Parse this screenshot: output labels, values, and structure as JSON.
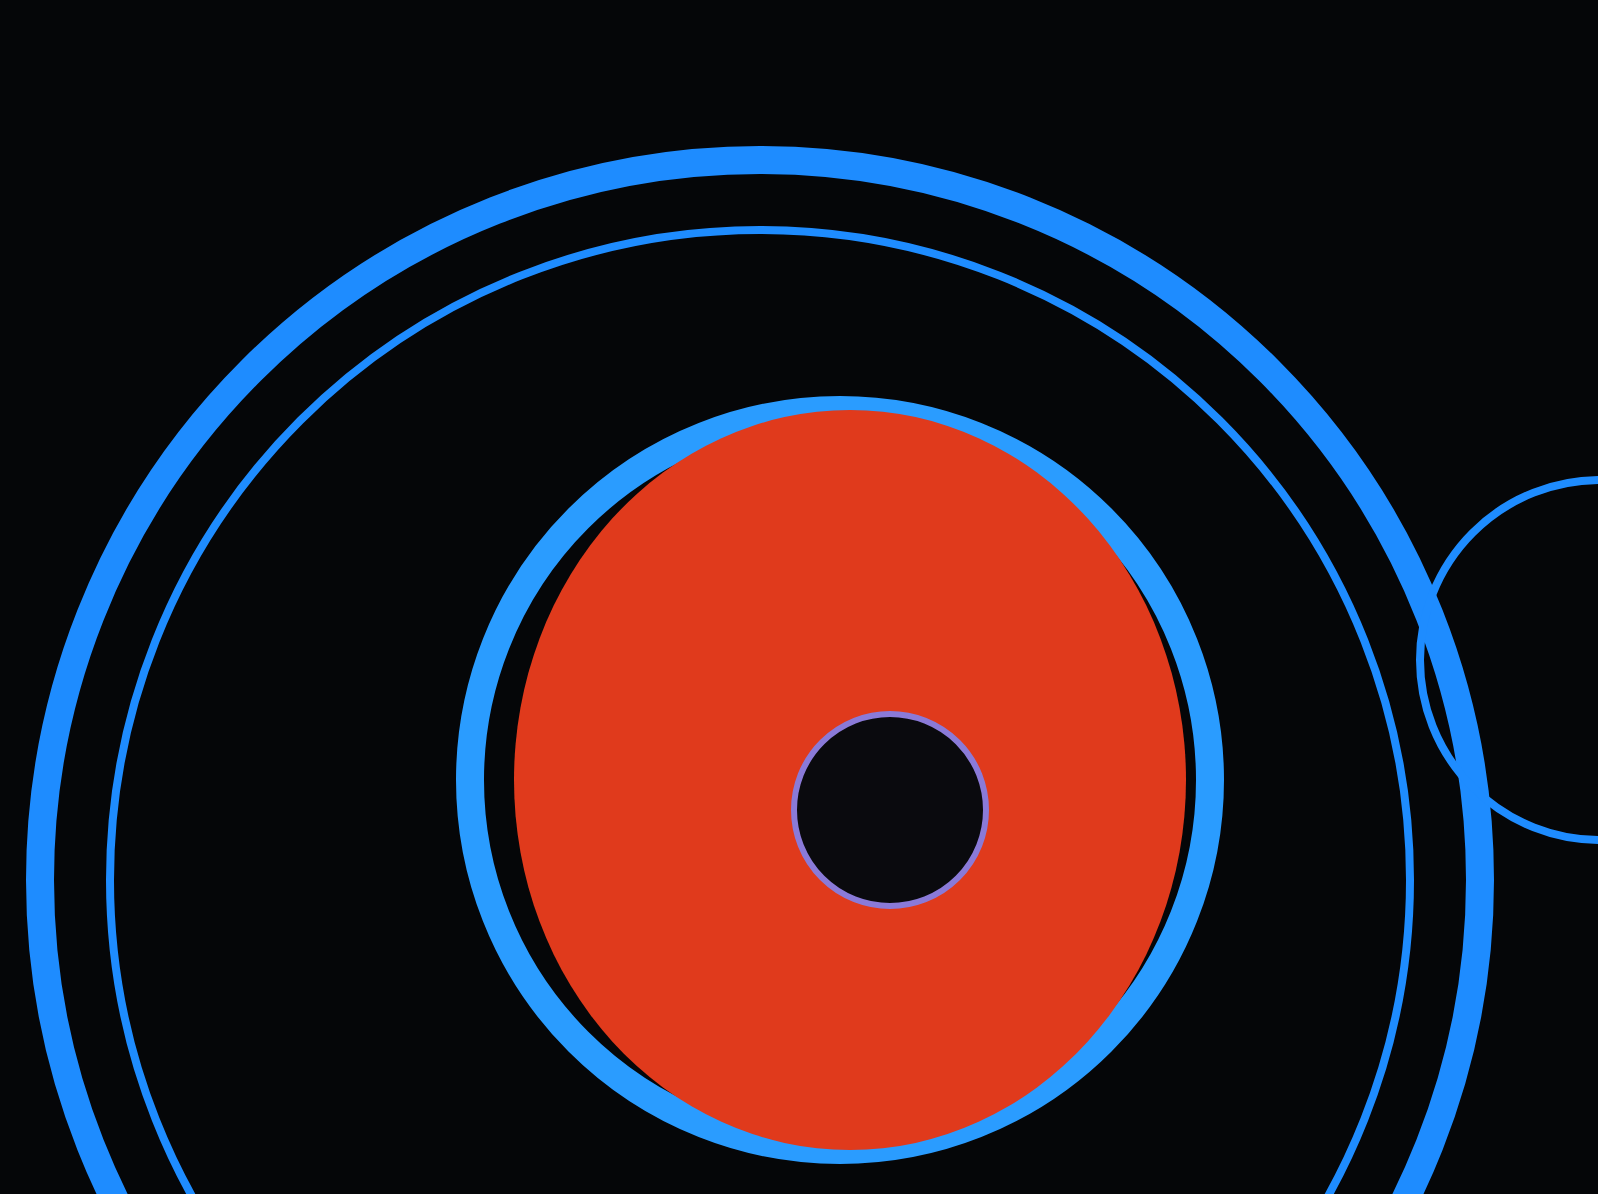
{
  "photo": {
    "kind": "gauge"
  }
}
